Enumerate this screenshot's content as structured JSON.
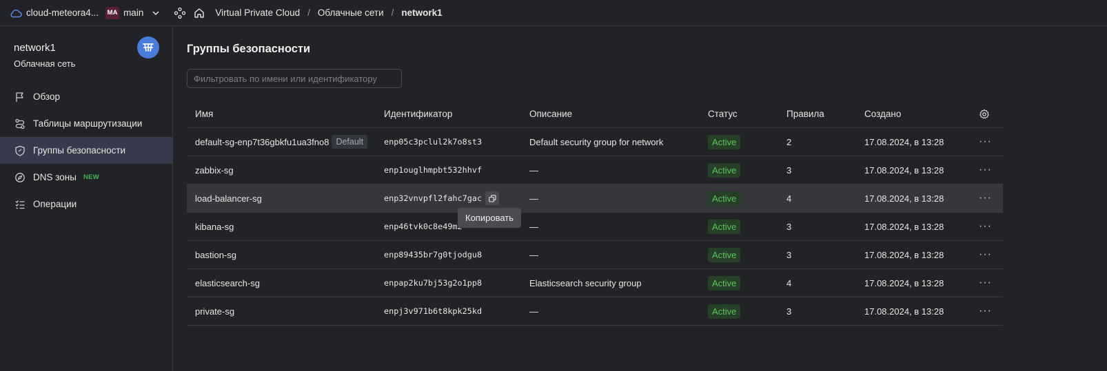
{
  "topbar": {
    "cloud_name": "cloud-meteora4...",
    "folder_badge": "MA",
    "folder_name": "main",
    "breadcrumbs": [
      "Virtual Private Cloud",
      "Облачные сети",
      "network1"
    ]
  },
  "sidebar": {
    "title": "network1",
    "subtitle": "Облачная сеть",
    "items": [
      {
        "label": "Обзор",
        "icon": "flag-icon"
      },
      {
        "label": "Таблицы маршрутизации",
        "icon": "route-icon"
      },
      {
        "label": "Группы безопасности",
        "icon": "shield-icon",
        "active": true
      },
      {
        "label": "DNS зоны",
        "icon": "compass-icon",
        "badge": "NEW"
      },
      {
        "label": "Операции",
        "icon": "list-icon"
      }
    ]
  },
  "main": {
    "title": "Группы безопасности",
    "filter_placeholder": "Фильтровать по имени или идентификатору",
    "columns": [
      "Имя",
      "Идентификатор",
      "Описание",
      "Статус",
      "Правила",
      "Создано"
    ],
    "rows": [
      {
        "name": "default-sg-enp7t36gbkfu1ua3fno8",
        "tag": "Default",
        "id": "enp05c3pclul2k7o8st3",
        "desc": "Default security group for network",
        "status": "Active",
        "rules": "2",
        "created": "17.08.2024, в 13:28"
      },
      {
        "name": "zabbix-sg",
        "id": "enp1ouglhmpbt532hhvf",
        "desc": "—",
        "status": "Active",
        "rules": "3",
        "created": "17.08.2024, в 13:28"
      },
      {
        "name": "load-balancer-sg",
        "id": "enp32vnvpfl2fahc7gac",
        "desc": "—",
        "status": "Active",
        "rules": "4",
        "created": "17.08.2024, в 13:28"
      },
      {
        "name": "kibana-sg",
        "id": "enp46tvk0c8e49m2",
        "desc": "—",
        "status": "Active",
        "rules": "3",
        "created": "17.08.2024, в 13:28"
      },
      {
        "name": "bastion-sg",
        "id": "enp89435br7g0tjodgu8",
        "desc": "—",
        "status": "Active",
        "rules": "3",
        "created": "17.08.2024, в 13:28"
      },
      {
        "name": "elasticsearch-sg",
        "id": "enpap2ku7bj53g2o1pp8",
        "desc": "Elasticsearch security group",
        "status": "Active",
        "rules": "4",
        "created": "17.08.2024, в 13:28"
      },
      {
        "name": "private-sg",
        "id": "enpj3v971b6t8kpk25kd",
        "desc": "—",
        "status": "Active",
        "rules": "3",
        "created": "17.08.2024, в 13:28"
      }
    ],
    "more_label": "···",
    "tooltip": "Копировать"
  },
  "colors": {
    "background": "#222326",
    "accent": "#4a7ddb",
    "status_active": "#5cc25f",
    "active_nav": "#363a4a"
  }
}
